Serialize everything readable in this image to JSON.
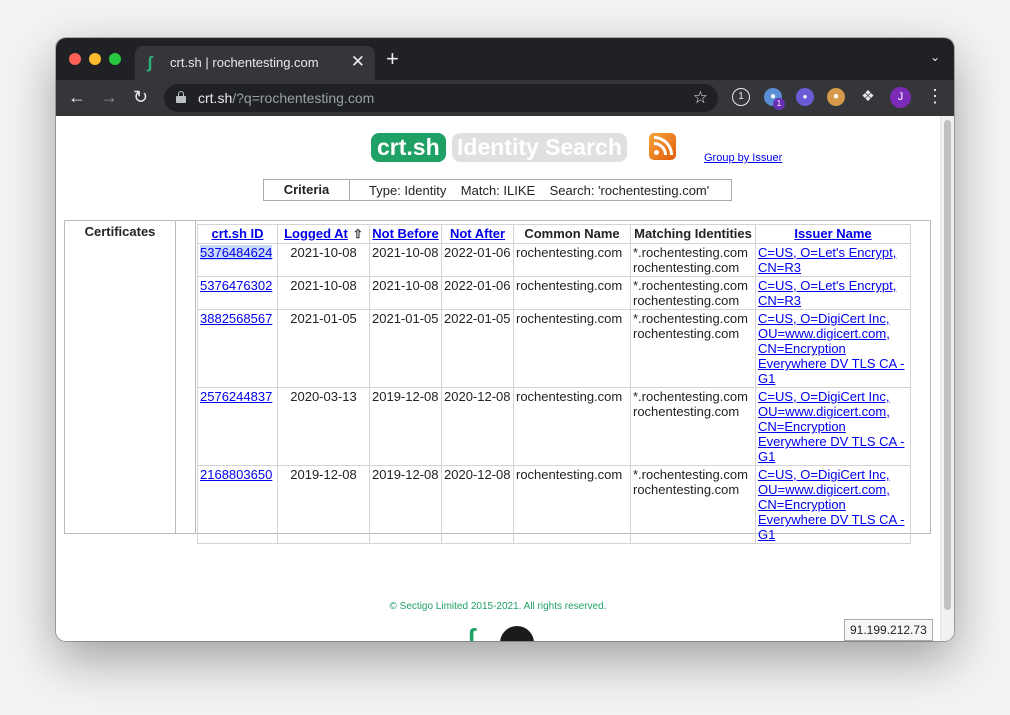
{
  "browser": {
    "tab_title": "crt.sh | rochentesting.com",
    "tab_close": "✕",
    "new_tab": "+",
    "url_host": "crt.sh",
    "url_path": "/?q=rochentesting.com",
    "extension_badge": "1",
    "avatar_letter": "J"
  },
  "header": {
    "logo_text": "crt.sh",
    "title_text": "Identity Search",
    "group_link": "Group by Issuer"
  },
  "criteria": {
    "label": "Criteria",
    "value": "Type: Identity    Match: ILIKE    Search: 'rochentesting.com'"
  },
  "certificates": {
    "section_label": "Certificates",
    "columns": [
      "crt.sh ID",
      "Logged At",
      "Not Before",
      "Not After",
      "Common Name",
      "Matching Identities",
      "Issuer Name"
    ],
    "rows": [
      {
        "id": "5376484624",
        "logged_at": "2021-10-08",
        "not_before": "2021-10-08",
        "not_after": "2022-01-06",
        "common_name": "rochentesting.com",
        "identities": [
          "*.rochentesting.com",
          "rochentesting.com"
        ],
        "issuer": "C=US, O=Let's Encrypt, CN=R3",
        "selected": true
      },
      {
        "id": "5376476302",
        "logged_at": "2021-10-08",
        "not_before": "2021-10-08",
        "not_after": "2022-01-06",
        "common_name": "rochentesting.com",
        "identities": [
          "*.rochentesting.com",
          "rochentesting.com"
        ],
        "issuer": "C=US, O=Let's Encrypt, CN=R3",
        "selected": false
      },
      {
        "id": "3882568567",
        "logged_at": "2021-01-05",
        "not_before": "2021-01-05",
        "not_after": "2022-01-05",
        "common_name": "rochentesting.com",
        "identities": [
          "*.rochentesting.com",
          "rochentesting.com"
        ],
        "issuer": "C=US, O=DigiCert Inc, OU=www.digicert.com, CN=Encryption Everywhere DV TLS CA - G1",
        "selected": false
      },
      {
        "id": "2576244837",
        "logged_at": "2020-03-13",
        "not_before": "2019-12-08",
        "not_after": "2020-12-08",
        "common_name": "rochentesting.com",
        "identities": [
          "*.rochentesting.com",
          "rochentesting.com"
        ],
        "issuer": "C=US, O=DigiCert Inc, OU=www.digicert.com, CN=Encryption Everywhere DV TLS CA - G1",
        "selected": false
      },
      {
        "id": "2168803650",
        "logged_at": "2019-12-08",
        "not_before": "2019-12-08",
        "not_after": "2020-12-08",
        "common_name": "rochentesting.com",
        "identities": [
          "*.rochentesting.com",
          "rochentesting.com"
        ],
        "issuer": "C=US, O=DigiCert Inc, OU=www.digicert.com, CN=Encryption Everywhere DV TLS CA - G1",
        "selected": false
      }
    ]
  },
  "footer": {
    "copyright": "© Sectigo Limited 2015-2021. All rights reserved.",
    "ip": "91.199.212.73"
  },
  "colors": {
    "brand_green": "#1fa064",
    "link_blue": "#0000ee",
    "tab_bar": "#202124",
    "toolbar": "#35363a"
  },
  "icons": [
    "crtsh-favicon-icon",
    "close-icon",
    "plus-icon",
    "back-icon",
    "forward-icon",
    "reload-icon",
    "lock-icon",
    "star-icon",
    "onepassword-icon",
    "wappalyzer-icon",
    "techstack-icon",
    "cookie-icon",
    "extensions-puzzle-icon",
    "kebab-menu-icon",
    "rss-icon",
    "sort-up-icon",
    "github-icon"
  ]
}
